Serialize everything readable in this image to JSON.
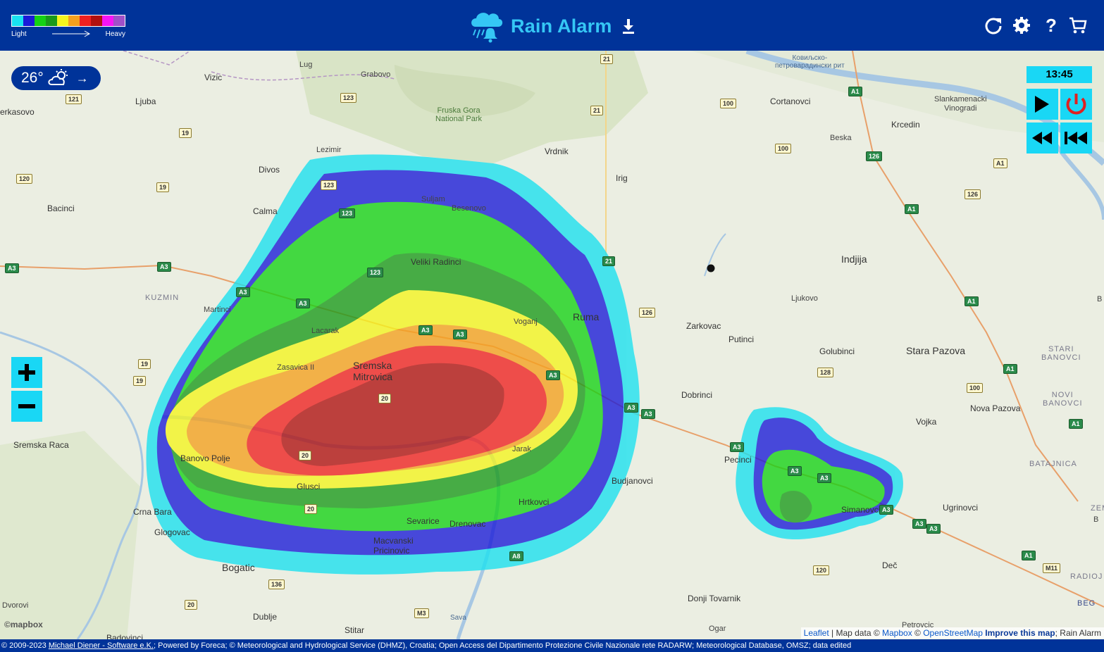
{
  "header": {
    "title": "Rain Alarm",
    "legend": {
      "light_label": "Light",
      "heavy_label": "Heavy",
      "colors": [
        "#19e1f0",
        "#1a1ad8",
        "#14d214",
        "#1a9a1a",
        "#f5f51e",
        "#f5a01e",
        "#f02020",
        "#b01010",
        "#f514f5",
        "#a050c8"
      ]
    },
    "icons": [
      "rain-alarm-logo-icon",
      "download-icon",
      "refresh-icon",
      "gear-icon",
      "help-icon",
      "cart-icon"
    ],
    "help_label": "?"
  },
  "weather": {
    "temperature": "26°",
    "condition_icon": "partly-cloudy-icon",
    "arrow": "→"
  },
  "playback": {
    "time": "13:45",
    "controls": [
      "play-icon",
      "power-icon",
      "rewind-icon",
      "skip-to-start-icon"
    ]
  },
  "zoom": {
    "in_icon": "plus-icon",
    "out_icon": "minus-icon"
  },
  "map": {
    "places": {
      "erkasovo": "erkasovo",
      "ljuba": "Ljuba",
      "vizic": "Vizic",
      "lug": "Lug",
      "grabovo": "Grabovo",
      "fruska_gora": "Fruska Gora\nNational Park",
      "vrdnik": "Vrdnik",
      "irig": "Irig",
      "lezimir": "Lezimir",
      "divos": "Divos",
      "bacinci": "Bacinci",
      "calma": "Calma",
      "kuzmin": "KUZMIN",
      "martinci": "Martinci",
      "suljam": "Suljam",
      "besenovo": "Besenovo",
      "veliki_radinci": "Veliki Radinci",
      "lacarak": "Lacarak",
      "voganj": "Voganj",
      "ruma": "Ruma",
      "zasavica": "Zasavica II",
      "sremska_mitrovica": "Sremska\nMitrovica",
      "sremska_raca": "Sremska Raca",
      "banovo_polje": "Banovo Polje",
      "jarak": "Jarak",
      "glusci": "Glusci",
      "crna_bara": "Crna Bara",
      "glogovac": "Glogovac",
      "sevarice": "Sevarice",
      "drenovac": "Drenovac",
      "hrtkovci": "Hrtkovci",
      "macvanski": "Macvanski\nPricinovic",
      "bogatic": "Bogatic",
      "dvorovi": "Dvorovi",
      "dublje": "Dublje",
      "badovinci": "Badovinci",
      "stitar": "Stitar",
      "sava": "Sava",
      "budjanovci": "Budjanovci",
      "donji_tovarnik": "Donji Tovarnik",
      "ogar": "Ogar",
      "petrovcic": "Petrovcic",
      "dobrinci": "Dobrinci",
      "pecinci": "Pecinci",
      "simanovci": "Simanovci",
      "dec": "Deč",
      "zarkovac": "Zarkovac",
      "putinci": "Putinci",
      "golubinci": "Golubinci",
      "ljukovo": "Ljukovo",
      "indjija": "Indjija",
      "stara_pazova": "Stara Pazova",
      "nova_pazova": "Nova Pazova",
      "vojka": "Vojka",
      "ugrinovci": "Ugrinovci",
      "batajnica": "BATAJNICA",
      "stari_banovci": "STARI\nBANOVCI",
      "novi_banovci": "NOVI\nBANOVCI",
      "krcedin": "Krcedin",
      "beska": "Beska",
      "cortanovci": "Cortanovci",
      "slankamen": "Slankamenacki\nVinogradi",
      "kovilj": "Ковиљско-\nпетроварадински рит",
      "radijo": "RADIOJ",
      "zem": "ZEM",
      "beg": "BEG",
      "b_right": "B",
      "b_right2": "B"
    },
    "roads": [
      "121",
      "123",
      "19",
      "120",
      "19",
      "A3",
      "A3",
      "21",
      "21",
      "100",
      "100",
      "A1",
      "A1",
      "126",
      "126",
      "A1",
      "123",
      "123",
      "123",
      "21",
      "A3",
      "A3",
      "A3",
      "A3",
      "126",
      "19",
      "19",
      "20",
      "20",
      "20",
      "A3",
      "A3",
      "A3",
      "A3",
      "A3",
      "128",
      "A1",
      "100",
      "A1",
      "A1",
      "A3",
      "120",
      "136",
      "20",
      "M3",
      "A8",
      "M11",
      "A1",
      "A3",
      "A3",
      "A3"
    ]
  },
  "attribution": {
    "leaflet": "Leaflet",
    "map_data": " | Map data © ",
    "mapbox": "Mapbox",
    "osm_sep": " © ",
    "osm": "OpenStreetMap",
    "improve": "Improve this map",
    "suffix": "; Rain Alarm",
    "mapbox_logo": "©mapbox"
  },
  "footer": {
    "prefix": "© 2009-2023 ",
    "author": "Michael Diener - Software e.K.",
    "rest": "; Powered by Foreca; © Meteorological and Hydrological Service (DHMZ), Croatia; Open Access del Dipartimento Protezione Civile Nazionale rete RADARW; Meteorological Database, OMSZ; data edited"
  }
}
